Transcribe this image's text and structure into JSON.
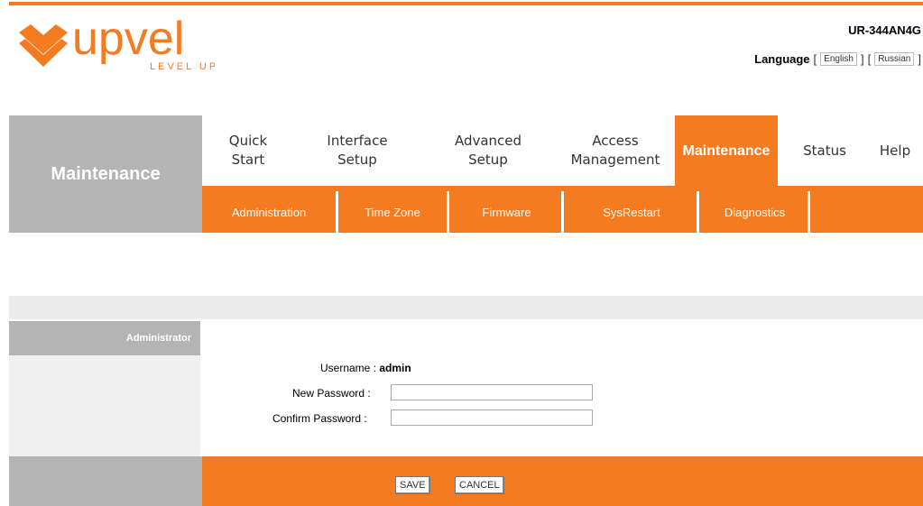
{
  "header": {
    "brand": "upvel",
    "tagline": "LEVEL UP",
    "model": "UR-344AN4G",
    "language_label": "Language",
    "language_options": [
      "English",
      "Russian"
    ]
  },
  "colors": {
    "accent": "#f47b20",
    "side_gray": "#b4b4b4"
  },
  "section_title": "Maintenance",
  "nav": {
    "items": [
      {
        "label": "Quick\nStart"
      },
      {
        "label": "Interface\nSetup"
      },
      {
        "label": "Advanced\nSetup"
      },
      {
        "label": "Access\nManagement"
      },
      {
        "label": "Maintenance"
      },
      {
        "label": "Status"
      },
      {
        "label": "Help"
      }
    ],
    "active": "Maintenance"
  },
  "subnav": {
    "items": [
      "Administration",
      "Time Zone",
      "Firmware",
      "SysRestart",
      "Diagnostics"
    ]
  },
  "form": {
    "section_label": "Administrator",
    "username_label": "Username : ",
    "username_value": "admin",
    "new_password_label": "New Password :",
    "new_password_value": "",
    "confirm_password_label": "Confirm Password :",
    "confirm_password_value": ""
  },
  "buttons": {
    "save": "SAVE",
    "cancel": "CANCEL"
  }
}
